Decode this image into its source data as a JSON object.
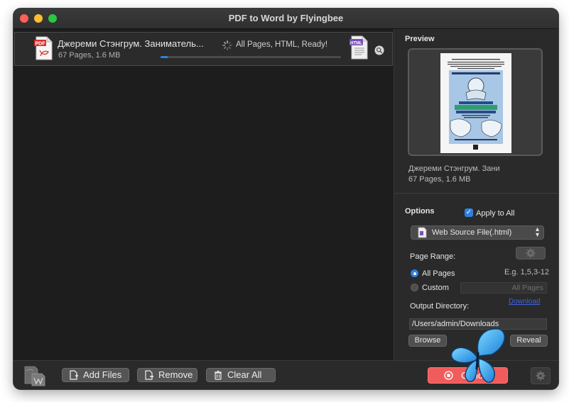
{
  "window": {
    "title": "PDF to Word by Flyingbee"
  },
  "file_list": {
    "items": [
      {
        "name": "Джереми Стэнгрум. Заниматель...",
        "meta": "67 Pages, 1.6 MB",
        "status": "All Pages, HTML, Ready!",
        "progress": 0.04,
        "source_icon_label": "PDF",
        "target_icon_label": "HTML"
      }
    ]
  },
  "preview": {
    "label": "Preview",
    "file_name": "Джереми Стэнгрум. Зани",
    "file_meta": "67 Pages, 1.6 MB"
  },
  "options": {
    "label": "Options",
    "apply_to_all": {
      "label": "Apply to All",
      "checked": true
    },
    "format": {
      "selected": "Web Source File(.html)"
    },
    "page_range": {
      "label": "Page Range:",
      "all_pages_label": "All Pages",
      "custom_label": "Custom",
      "example": "E.g. 1,5,3-12",
      "custom_placeholder": "All Pages",
      "selected": "all"
    },
    "output_directory": {
      "label": "Output Directory:",
      "link": "Download",
      "path": "/Users/admin/Downloads",
      "browse_label": "Browse",
      "reveal_label": "Reveal"
    }
  },
  "toolbar": {
    "add_files_label": "Add Files",
    "remove_label": "Remove",
    "clear_all_label": "Clear All",
    "cancel_label": "Cancel"
  },
  "colors": {
    "accent": "#2f7fe0",
    "cancel": "#f05b5b",
    "pdf_red": "#d8312b",
    "html_purple": "#7a4fb5",
    "link_blue": "#3f63e0"
  },
  "icons": {
    "source_file": "pdf-file-icon",
    "target_file": "html-file-icon",
    "spinner": "spinner-icon",
    "preview": "magnifier-icon",
    "settings": "gear-icon"
  }
}
